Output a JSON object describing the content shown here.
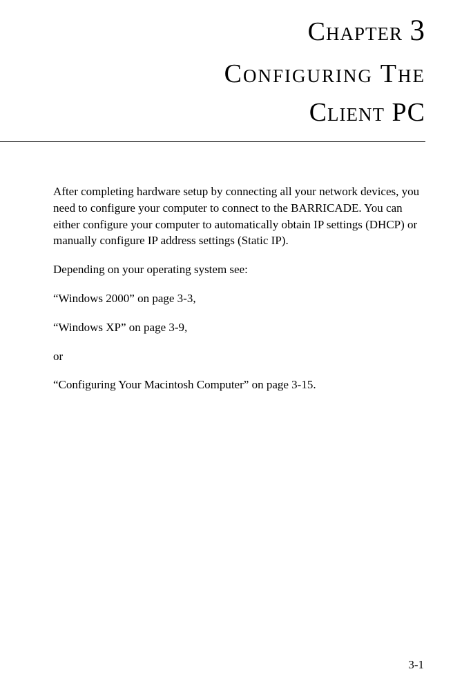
{
  "header": {
    "chapter_label": "Chapter",
    "chapter_number": "3",
    "title_line1": "Configuring The",
    "title_line2": "Client PC"
  },
  "body": {
    "p1": "After completing hardware setup by connecting all your network devices, you need to configure your computer to connect to the BARRICADE. You can either configure your computer to automatically obtain IP settings (DHCP) or manually configure IP address settings (Static IP).",
    "p2": "Depending on your operating system see:",
    "p3": "“Windows 2000” on page 3-3,",
    "p4": "“Windows XP” on page 3-9,",
    "p5": "or",
    "p6": "“Configuring Your Macintosh Computer” on page 3-15."
  },
  "footer": {
    "page_number": "3-1"
  }
}
